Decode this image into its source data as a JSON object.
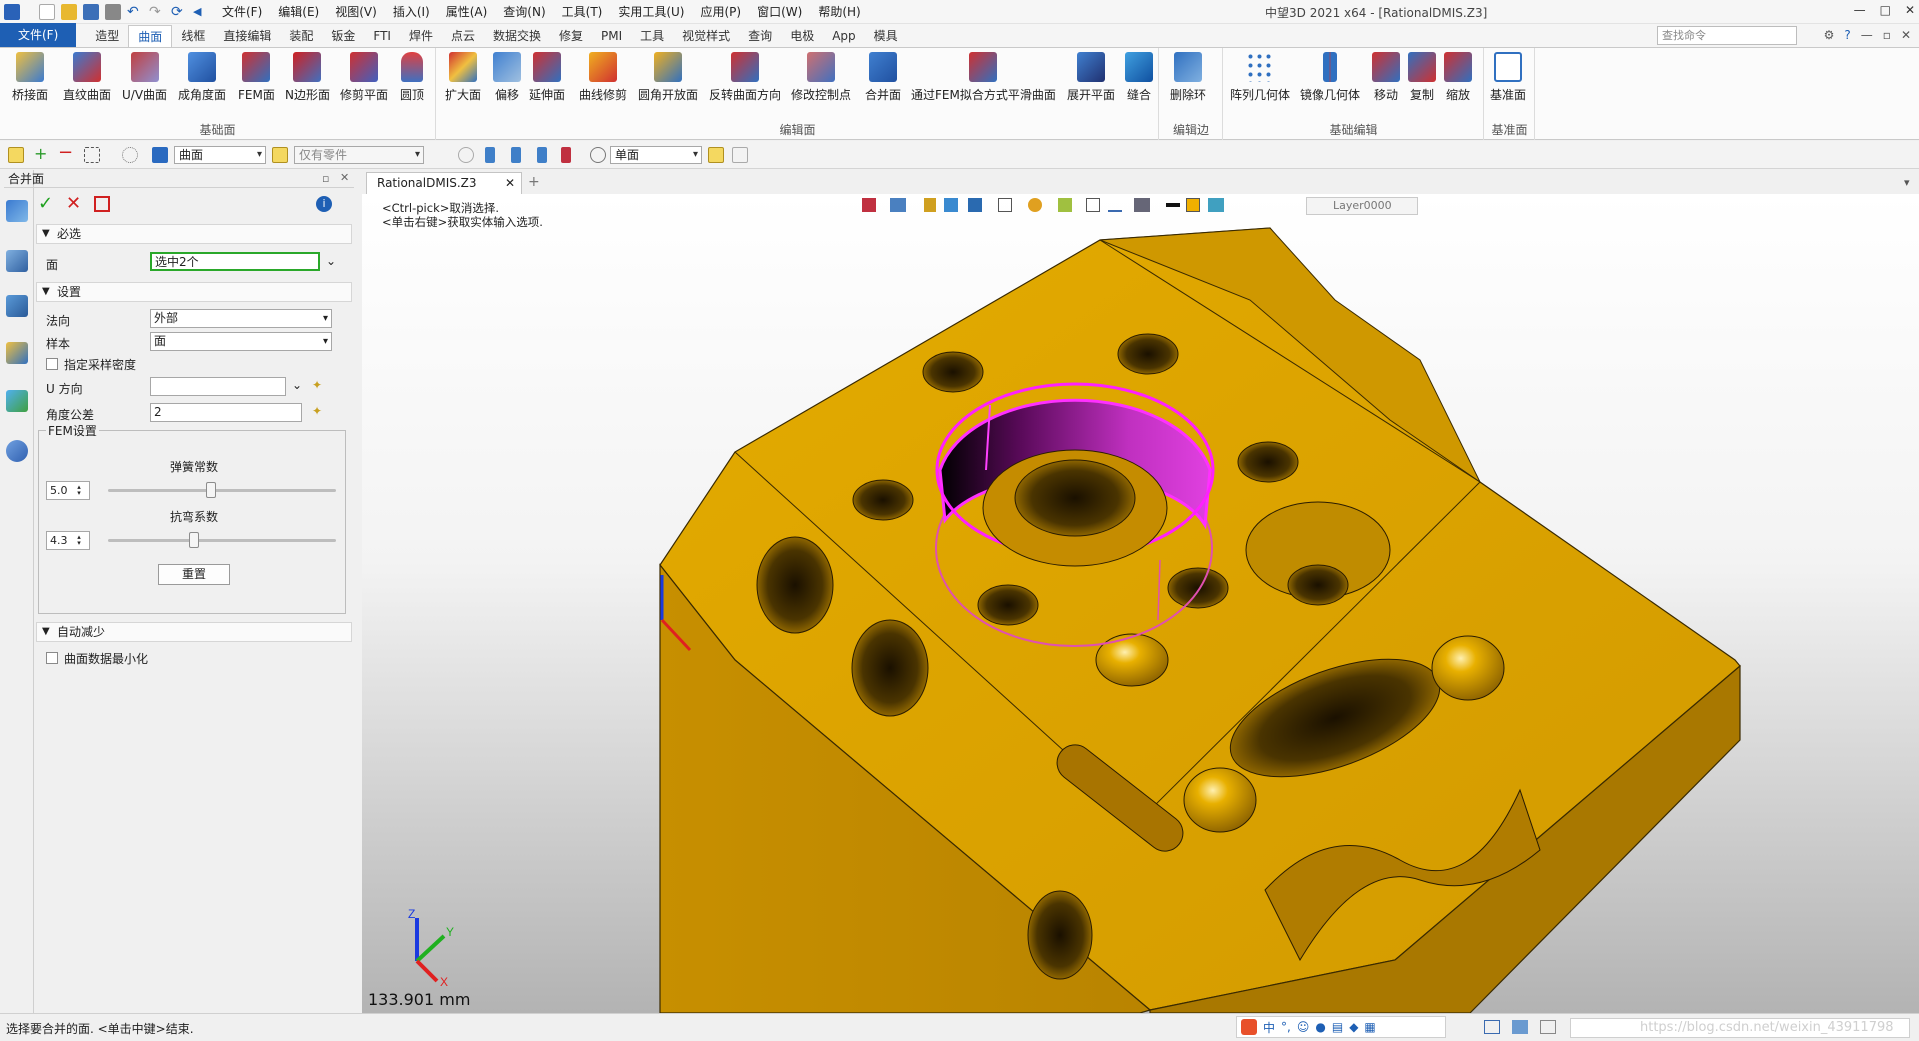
{
  "window": {
    "title": "中望3D 2021 x64 - [RationalDMIS.Z3]",
    "buttons": [
      "—",
      "□",
      "✕"
    ]
  },
  "menubar": [
    "文件(F)",
    "编辑(E)",
    "视图(V)",
    "插入(I)",
    "属性(A)",
    "查询(N)",
    "工具(T)",
    "实用工具(U)",
    "应用(P)",
    "窗口(W)",
    "帮助(H)"
  ],
  "ribbon_tabs": {
    "file": "文件(F)",
    "tabs": [
      "造型",
      "曲面",
      "线框",
      "直接编辑",
      "装配",
      "钣金",
      "FTI",
      "焊件",
      "点云",
      "数据交换",
      "修复",
      "PMI",
      "工具",
      "视觉样式",
      "查询",
      "电极",
      "App",
      "模具"
    ],
    "active": "曲面",
    "search_placeholder": "查找命令"
  },
  "ribbon": {
    "groups": [
      {
        "label": "基础面",
        "buttons": [
          "桥接面",
          "直纹曲面",
          "U/V曲面",
          "成角度面",
          "FEM面",
          "N边形面",
          "修剪平面",
          "圆顶"
        ]
      },
      {
        "label": "编辑面",
        "buttons": [
          "扩大面",
          "偏移",
          "延伸面",
          "曲线修剪",
          "圆角开放面",
          "反转曲面方向",
          "修改控制点",
          "合并面",
          "通过FEM拟合方式平滑曲面",
          "展开平面",
          "缝合"
        ]
      },
      {
        "label": "编辑边",
        "buttons": [
          "删除环"
        ]
      },
      {
        "label": "基础编辑",
        "buttons": [
          "阵列几何体",
          "镜像几何体",
          "移动",
          "复制",
          "缩放"
        ]
      },
      {
        "label": "基准面",
        "buttons": [
          "基准面"
        ]
      }
    ]
  },
  "filterbar": {
    "filter_value": "曲面",
    "part_filter": "仅有零件",
    "face_mode": "单面"
  },
  "panel": {
    "title": "合并面",
    "required_header": "必选",
    "face_label": "面",
    "face_value": "选中2个",
    "settings_header": "设置",
    "normal_label": "法向",
    "normal_value": "外部",
    "sample_label": "样本",
    "sample_value": "面",
    "sample_density_label": "指定采样密度",
    "u_dir_label": "U 方向",
    "u_dir_value": "",
    "angle_tol_label": "角度公差",
    "angle_tol_value": "2",
    "fem_group_label": "FEM设置",
    "spring_label": "弹簧常数",
    "spring_value": "5.0",
    "spring_level": 0.45,
    "bend_label": "抗弯系数",
    "bend_value": "4.3",
    "bend_level": 0.37,
    "reset_label": "重置",
    "auto_reduce_header": "自动减少",
    "minimize_label": "曲面数据最小化"
  },
  "document": {
    "tab": "RationalDMIS.Z3",
    "hint1": "<Ctrl-pick>取消选择.",
    "hint2": "<单击右键>获取实体输入选项.",
    "layer": "Layer0000",
    "scale": "133.901 mm",
    "axes": {
      "x": "X",
      "y": "Y",
      "z": "Z"
    }
  },
  "status": {
    "text": "选择要合并的面. <单击中键>结束.",
    "ime": "中",
    "watermark": "https://blog.csdn.net/weixin_43911798"
  },
  "colors": {
    "part": "#d9a100",
    "part_dark": "#8a6400",
    "selection": "#e020d0",
    "selection_fill": "#a020a0",
    "accent": "#1e5fb4"
  }
}
